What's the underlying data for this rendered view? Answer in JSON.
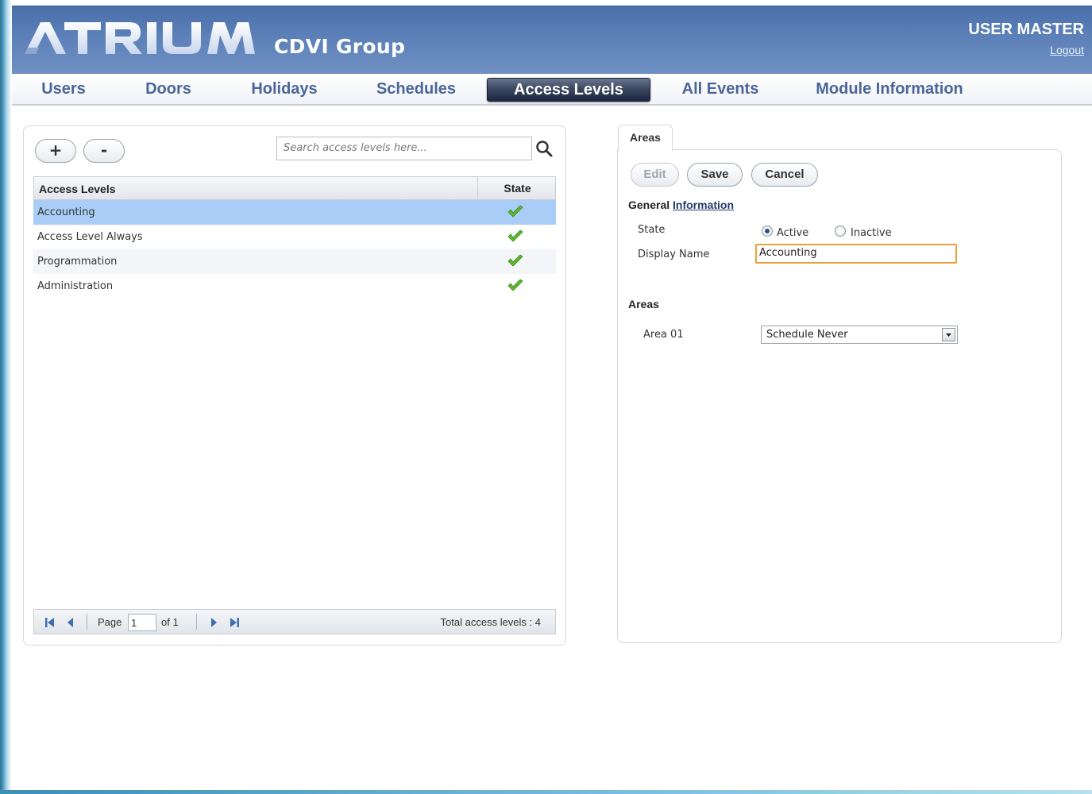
{
  "header": {
    "logo_text": "ATRIUM",
    "company": "CDVI Group",
    "user": "USER MASTER",
    "logout": "Logout"
  },
  "nav": {
    "items": [
      "Users",
      "Doors",
      "Holidays",
      "Schedules",
      "Access Levels",
      "All Events",
      "Module Information"
    ],
    "active": "Access Levels"
  },
  "list_panel": {
    "add_label": "+",
    "remove_label": "-",
    "search_placeholder": "Search access levels here...",
    "columns": [
      "Access Levels",
      "State"
    ],
    "rows": [
      {
        "name": "Accounting",
        "state": "active",
        "selected": true
      },
      {
        "name": "Access Level Always",
        "state": "active",
        "selected": false
      },
      {
        "name": "Programmation",
        "state": "active",
        "selected": false
      },
      {
        "name": "Administration",
        "state": "active",
        "selected": false
      }
    ],
    "pager": {
      "page_label": "Page",
      "page_value": "1",
      "of_label": "of 1",
      "total": "Total access levels  : 4"
    }
  },
  "detail_panel": {
    "tab": "Areas",
    "buttons": {
      "edit": "Edit",
      "save": "Save",
      "cancel": "Cancel"
    },
    "general_title_a": "General",
    "general_title_b": "Information",
    "state_label": "State",
    "state_options": [
      "Active",
      "Inactive"
    ],
    "state_value": "Active",
    "display_name_label": "Display Name",
    "display_name_value": "Accounting",
    "areas_title": "Areas",
    "areas": [
      {
        "label": "Area 01",
        "value": "Schedule Never"
      }
    ]
  },
  "colors": {
    "header": "#5c80b8",
    "nav_text": "#4a6699",
    "selected_row": "#a9cdf6",
    "check": "#5cb82e",
    "focus_border": "#e8a23a"
  }
}
